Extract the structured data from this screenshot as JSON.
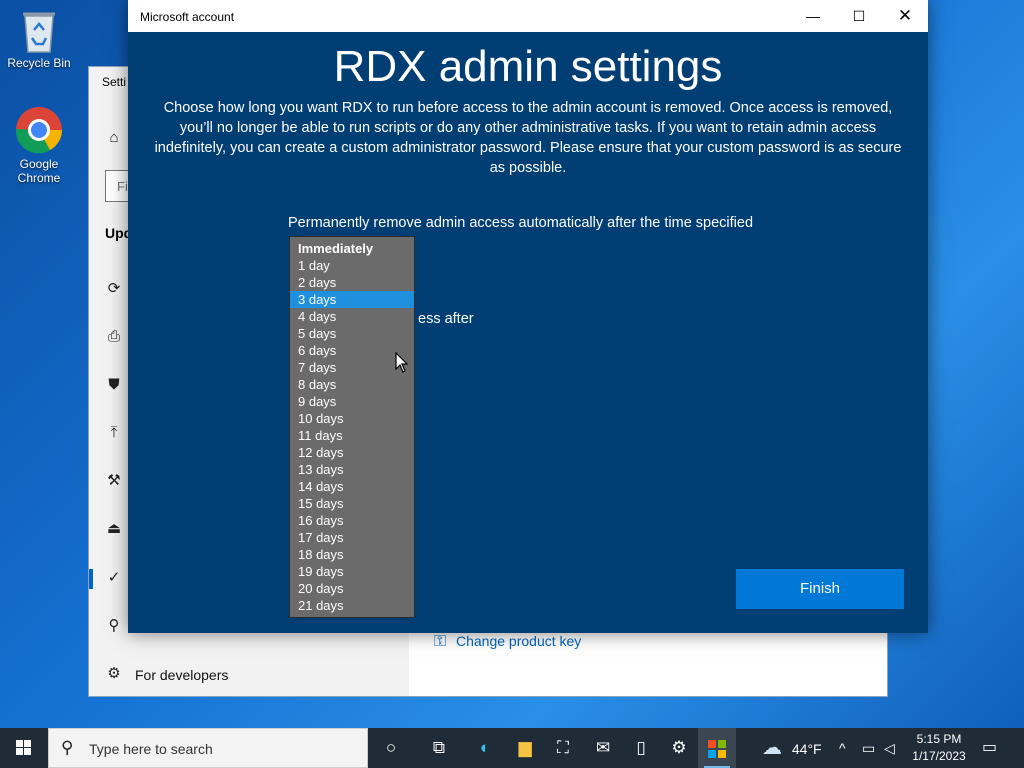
{
  "desktop": {
    "icons": [
      {
        "label": "Recycle Bin"
      },
      {
        "label": "Google Chrome"
      }
    ]
  },
  "settings_window": {
    "title": "Setti",
    "search_placeholder": "Fi",
    "heading": "Upd",
    "developers_label": "For developers",
    "change_key_link": "Change product key"
  },
  "dialog": {
    "window_title": "Microsoft account",
    "heading": "RDX admin settings",
    "description": "Choose how long you want RDX to run before access to the admin account is removed. Once access is removed, you’ll no longer be able to run scripts or do any other administrative tasks. If you want to retain admin access indefinitely, you can create a custom administrator password. Please ensure that your custom password is as secure as possible.",
    "option_label": "Permanently remove admin access automatically after the time specified",
    "partial_label": "ess after",
    "finish_button": "Finish",
    "dropdown": {
      "selected": "3 days",
      "options": [
        "Immediately",
        "1 day",
        "2 days",
        "3 days",
        "4 days",
        "5 days",
        "6 days",
        "7 days",
        "8 days",
        "9 days",
        "10 days",
        "11 days",
        "12 days",
        "13 days",
        "14 days",
        "15 days",
        "16 days",
        "17 days",
        "18 days",
        "19 days",
        "20 days",
        "21 days"
      ]
    }
  },
  "taskbar": {
    "search_placeholder": "Type here to search",
    "weather_temp": "44°F",
    "time": "5:15 PM",
    "date": "1/17/2023"
  },
  "colors": {
    "dialog_bg": "#003e73",
    "accent": "#0078d7",
    "dropdown_bg": "#6b6b6b",
    "dropdown_selected": "#1e90dd"
  }
}
